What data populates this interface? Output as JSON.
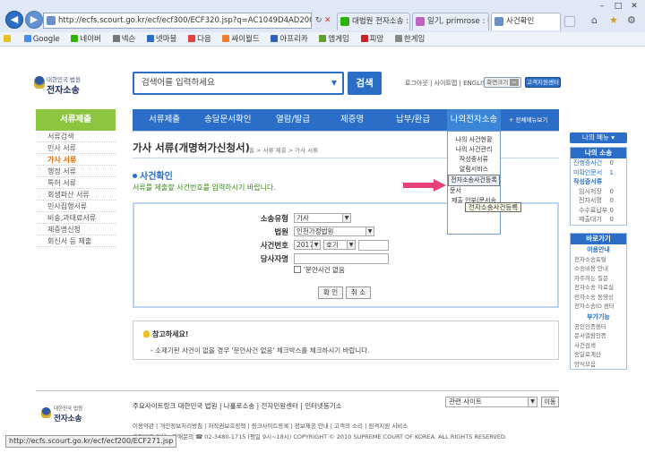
{
  "browser": {
    "address": "http://ecfs.scourt.go.kr/ecf/ecf300/ECF320.jsp?q=AC1049D4AD2000840B2",
    "tabs": [
      "대법원 전자소송 : 네...",
      "일기, primrose : 네이...",
      "사건확인"
    ],
    "favorites": [
      "Google",
      "네이버",
      "넥슨",
      "넷마블",
      "다음",
      "싸이월드",
      "아프리카",
      "엠게임",
      "피망",
      "한게임"
    ],
    "status_url": "http://ecfs.scourt.go.kr/ecf/ecf200/ECF271.jsp"
  },
  "header": {
    "logo_small": "대한민국 법원",
    "logo_name": "전자소송",
    "search_placeholder": "검색어를 입력하세요",
    "search_button": "검색",
    "top_links": "로그아웃 | 사이트맵 | ENGLISH",
    "font_label": "화면크기",
    "customer_center": "고객지원센터"
  },
  "main_nav": [
    "서류제출",
    "송달문서확인",
    "열람/발급",
    "제증명",
    "납부/환급",
    "나의전자소송"
  ],
  "all_menu": "+ 전체메뉴보기",
  "left_nav": {
    "title": "서류제출",
    "items": [
      "서류검색",
      "민사 서류",
      "가사 서류",
      "행정 서류",
      "특허 서류",
      "회생파산 서류",
      "민사집행서류",
      "비송,과태료서류",
      "제증명신청",
      "회신서 등 제출"
    ],
    "active_index": 2
  },
  "content": {
    "title": "가사 서류(개명허가신청서)",
    "breadcrumb": "홈 > 서류 제출 > 가사 서류",
    "section_title": "사건확인",
    "description": "서류를 제출할 사건번호를 입력하시기 바랍니다.",
    "form": {
      "case_type_label": "소송유형",
      "case_type_value": "가사",
      "court_label": "법원",
      "court_value": "인천가정법원",
      "case_no_label": "사건번호",
      "case_year": "2017",
      "case_kind": "호기",
      "party_label": "당사자명",
      "no_case_label": "'문안사건 없음",
      "confirm_button": "확 인",
      "cancel_button": "취 소"
    },
    "note_title": "참고하세요!",
    "note_text": "- 소제기된 사건이 없을 경우 '문안사건 없음' 체크박스를 체크하시기 바랍니다."
  },
  "dropdown_menu": {
    "items": [
      "나의 사건현황",
      "나의 사건관리",
      "작성중서류",
      "알림서비스",
      "전자소송사건등록",
      "문서",
      "제출 인부(문서송부)"
    ],
    "highlight_index": 4,
    "tooltip": "전자소송사건등록"
  },
  "right_panel": {
    "my_menu_button": "나의 메뉴 ▾",
    "my_litigation": {
      "title": "나의 소송",
      "rows": [
        {
          "label": "진행중사건",
          "count": "0"
        },
        {
          "label": "미확인문서",
          "count": "1"
        }
      ],
      "sub_title": "작성중서류",
      "sub_rows": [
        "임시저장",
        "전자서명",
        "수수료납부",
        "제출대기"
      ],
      "sub_counts": [
        "0",
        "0",
        "0",
        "0"
      ]
    },
    "shortcut": {
      "title": "바로가기",
      "guide_title": "이용안내",
      "guide_items": [
        "전자소송포털",
        "소송비용 안내",
        "자주하는 질문",
        "전자소송 자료실",
        "전자소송 동영상",
        "전자소송ID 센터"
      ],
      "help_title": "부가기능",
      "help_items": [
        "공인인증센터",
        "문서열람인증",
        "사건검색",
        "송달료계산",
        "양식모음"
      ]
    }
  },
  "footer": {
    "logo_small": "대한민국 법원",
    "logo_name": "전자소송",
    "links": "주요사이트링크   대한민국 법원  |  나홀로소송  |  전자민원센터  |  인터넷등기소",
    "related_site": "관련 사이트",
    "go_button": "이동",
    "line2": "이용약관 | 개인정보처리방침 | 저작권보호정책 | 링크사이트등록 | 정보제공 안내 | 고객의 소리 | 원격지원 서비스",
    "line3": "우편번호 이용 · 장애문의 ☎ 02-3480-1715 (평일 9시~18시)    COPYRIGHT © 2010 SUPREME COURT OF KOREA. ALL RIGHTS RESERVED."
  },
  "colors": {
    "primary_blue": "#2a6ec8",
    "left_nav_green": "#8cc63f",
    "arrow_pink": "#e8407a"
  }
}
